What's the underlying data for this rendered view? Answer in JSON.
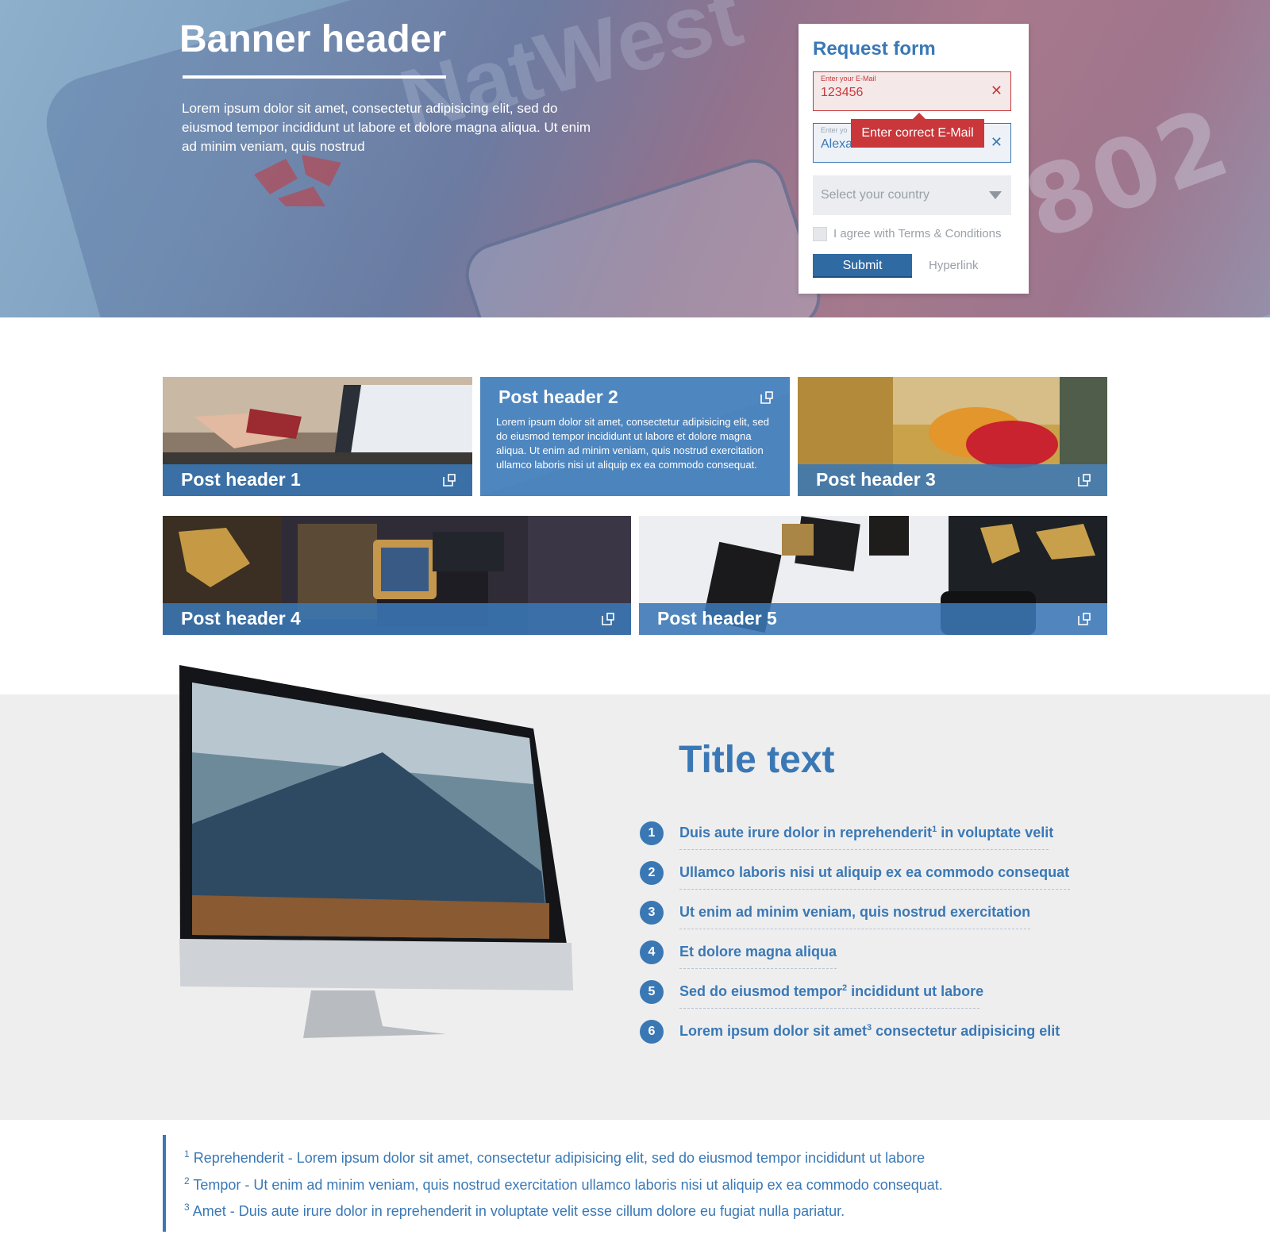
{
  "banner": {
    "title": "Banner header",
    "text": "Lorem ipsum dolor sit amet, consectetur adipisicing elit, sed do eiusmod tempor incididunt ut labore et dolore magna aliqua. Ut enim ad minim veniam, quis nostrud"
  },
  "form": {
    "title": "Request form",
    "email": {
      "label": "Enter your E-Mail",
      "value": "123456",
      "clear": "✕"
    },
    "name": {
      "label": "Enter yo",
      "value": "Alexa",
      "clear": "✕"
    },
    "error_tooltip": "Enter correct E-Mail",
    "country_placeholder": "Select your country",
    "terms_label": "I agree with Terms & Conditions",
    "submit_label": "Submit",
    "hyperlink_label": "Hyperlink",
    "colors": {
      "accent": "#3a78b5",
      "error": "#c9373b",
      "submit": "#2f6aa3"
    }
  },
  "posts": [
    {
      "title": "Post header 1",
      "icon": "external-link-icon"
    },
    {
      "title": "Post header 2",
      "text": "Lorem ipsum dolor sit amet, consectetur adipisicing elit, sed do eiusmod tempor incididunt ut labore et dolore magna aliqua. Ut enim ad minim veniam, quis nostrud exercitation ullamco laboris nisi ut aliquip ex ea commodo consequat.",
      "icon": "external-link-icon"
    },
    {
      "title": "Post header 3",
      "icon": "external-link-icon"
    },
    {
      "title": "Post header 4",
      "icon": "external-link-icon"
    },
    {
      "title": "Post header 5",
      "icon": "external-link-icon"
    }
  ],
  "feature": {
    "title": "Title text",
    "items": [
      {
        "num": "1",
        "text": "Duis aute irure dolor in reprehenderit",
        "sup": "1",
        "after": " in voluptate velit"
      },
      {
        "num": "2",
        "text": "Ullamco laboris nisi ut aliquip ex ea commodo consequat",
        "sup": "",
        "after": ""
      },
      {
        "num": "3",
        "text": "Ut enim ad minim veniam, quis nostrud exercitation",
        "sup": "",
        "after": ""
      },
      {
        "num": "4",
        "text": "Et dolore magna aliqua",
        "sup": "",
        "after": ""
      },
      {
        "num": "5",
        "text": "Sed do eiusmod tempor",
        "sup": "2",
        "after": " incididunt ut labore"
      },
      {
        "num": "6",
        "text": "Lorem ipsum dolor sit amet",
        "sup": "3",
        "after": " consectetur adipisicing elit"
      }
    ]
  },
  "footnotes": [
    {
      "num": "1",
      "text": " Reprehenderit - Lorem ipsum dolor sit amet, consectetur adipisicing elit, sed do eiusmod tempor incididunt ut labore"
    },
    {
      "num": "2",
      "text": " Tempor - Ut enim ad minim veniam, quis nostrud exercitation ullamco laboris nisi ut aliquip ex ea commodo consequat."
    },
    {
      "num": "3",
      "text": " Amet - Duis aute irure dolor in reprehenderit in voluptate velit esse cillum dolore eu fugiat nulla pariatur."
    }
  ]
}
